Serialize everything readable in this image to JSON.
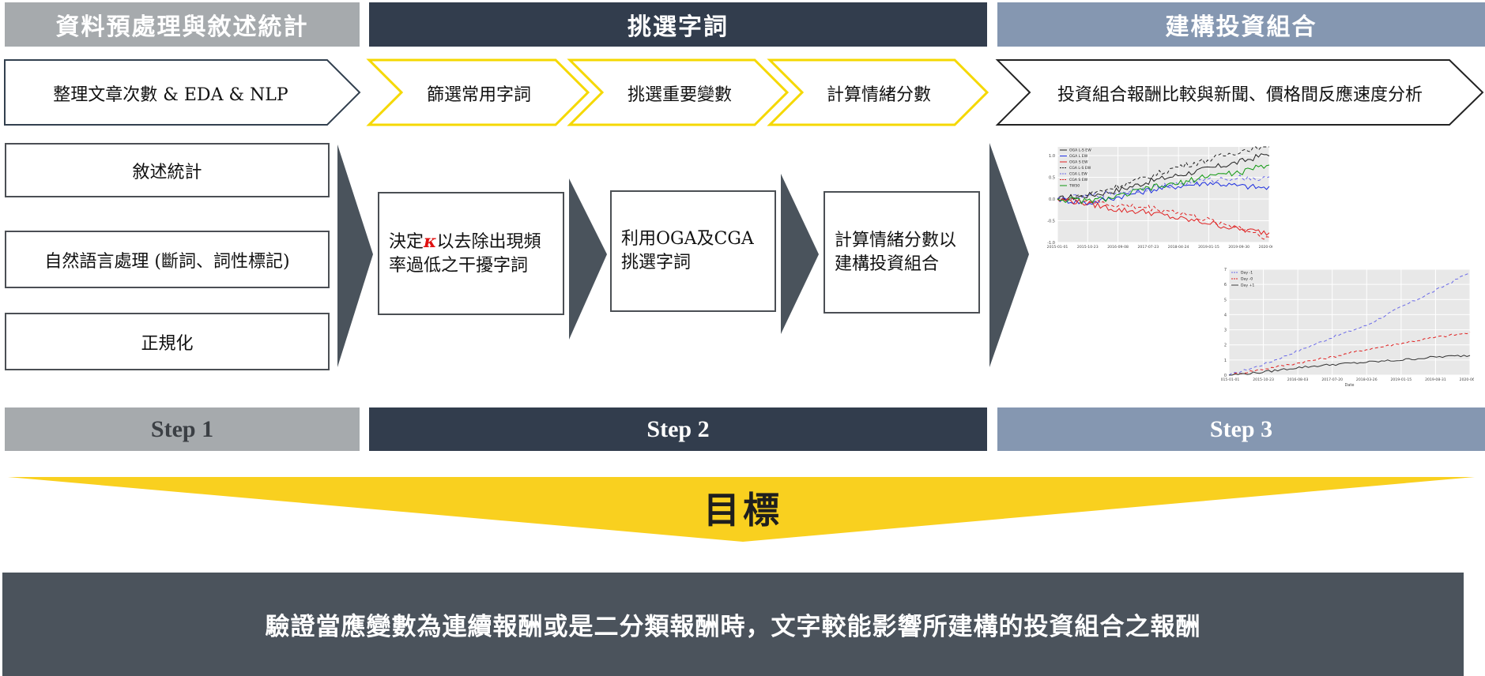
{
  "headers": {
    "section1": "資料預處理與敘述統計",
    "section2": "挑選字詞",
    "section3": "建構投資組合"
  },
  "chevrons": {
    "c1": "整理文章次數 & EDA & NLP",
    "c2": "篩選常用字詞",
    "c3": "挑選重要變數",
    "c4": "計算情緒分數",
    "c5": "投資組合報酬比較與新聞、價格間反應速度分析"
  },
  "step1_boxes": [
    "敘述統計",
    "自然語言處理 (斷詞、詞性標記)",
    "正規化"
  ],
  "step2_boxes": {
    "b1_kappa": "κ",
    "b1_pre": "決定",
    "b1_post": "以去除出現頻率過低之干擾字詞",
    "b2": "利用OGA及CGA挑選字詞",
    "b3": "計算情緒分數以建構投資組合"
  },
  "steps": [
    "Step 1",
    "Step 2",
    "Step 3"
  ],
  "goal": "目標",
  "conclusion": "驗證當應變數為連續報酬或是二分類報酬時，文字較能影響所建構的投資組合之報酬",
  "colors": {
    "gray": "#a6aaad",
    "dark": "#323d4d",
    "blue": "#8597b1",
    "yellow": "#f9d01f",
    "bottom": "#4b535c"
  },
  "chart_data": [
    {
      "type": "line",
      "x": [
        "2015-01-01",
        "2015-10-23",
        "2016-09-08",
        "2017-07-23",
        "2018-04-24",
        "2019-01-15",
        "2019-09-30",
        "2020-06-25"
      ],
      "ylim": [
        -1.0,
        1.2
      ],
      "yticks": [
        "1.0",
        "0.5",
        "0.0",
        "-0.5",
        "-1.0"
      ],
      "legend": [
        "OGA L-S  EW",
        "OGA L  EW",
        "OGA S  EW",
        "CGA L-S  EW",
        "CGA L  EW",
        "CGA S  EW",
        "TW50"
      ],
      "series": [
        {
          "name": "OGA L-S  EW",
          "color": "#222222",
          "dash": "",
          "values": [
            0.0,
            0.08,
            0.2,
            0.4,
            0.55,
            0.7,
            0.85,
            1.05
          ]
        },
        {
          "name": "OGA L  EW",
          "color": "#1b2de0",
          "dash": "",
          "values": [
            0.0,
            -0.1,
            0.05,
            0.2,
            0.3,
            0.38,
            0.3,
            0.25
          ]
        },
        {
          "name": "OGA S  EW",
          "color": "#e02020",
          "dash": "",
          "values": [
            0.0,
            -0.1,
            -0.25,
            -0.3,
            -0.45,
            -0.55,
            -0.7,
            -0.78
          ]
        },
        {
          "name": "CGA L-S  EW",
          "color": "#222222",
          "dash": "4,3",
          "values": [
            0.0,
            0.1,
            0.3,
            0.5,
            0.75,
            0.9,
            1.1,
            1.25
          ]
        },
        {
          "name": "CGA L  EW",
          "color": "#6a6ae8",
          "dash": "4,3",
          "values": [
            0.0,
            0.05,
            0.15,
            0.25,
            0.35,
            0.42,
            0.5,
            0.45
          ]
        },
        {
          "name": "CGA S  EW",
          "color": "#e02020",
          "dash": "4,3",
          "values": [
            0.0,
            -0.05,
            -0.15,
            -0.2,
            -0.3,
            -0.5,
            -0.65,
            -0.9
          ]
        },
        {
          "name": "TW50",
          "color": "#119911",
          "dash": "",
          "values": [
            0.0,
            -0.05,
            0.05,
            0.25,
            0.35,
            0.55,
            0.6,
            0.8
          ]
        }
      ]
    },
    {
      "type": "line",
      "x": [
        "2015-01-01",
        "2015-10-23",
        "2016-08-03",
        "2017-07-20",
        "2018-03-26",
        "2019-01-15",
        "2019-08-31",
        "2020-06-19"
      ],
      "xlabel": "Date",
      "ylim": [
        0,
        7
      ],
      "yticks": [
        "7",
        "6",
        "5",
        "4",
        "3",
        "2",
        "1",
        "0"
      ],
      "legend": [
        "Day -1",
        "Day -0",
        "Day +1"
      ],
      "series": [
        {
          "name": "Day -1",
          "color": "#6a6ae8",
          "dash": "4,3",
          "values": [
            0.0,
            0.7,
            1.6,
            2.5,
            3.3,
            4.5,
            5.6,
            6.8
          ]
        },
        {
          "name": "Day -0",
          "color": "#e02020",
          "dash": "4,3",
          "values": [
            0.0,
            0.4,
            0.8,
            1.2,
            1.7,
            2.1,
            2.5,
            2.8
          ]
        },
        {
          "name": "Day +1",
          "color": "#333333",
          "dash": "",
          "values": [
            0.0,
            0.2,
            0.5,
            0.7,
            0.85,
            1.0,
            1.2,
            1.3
          ]
        }
      ]
    }
  ]
}
